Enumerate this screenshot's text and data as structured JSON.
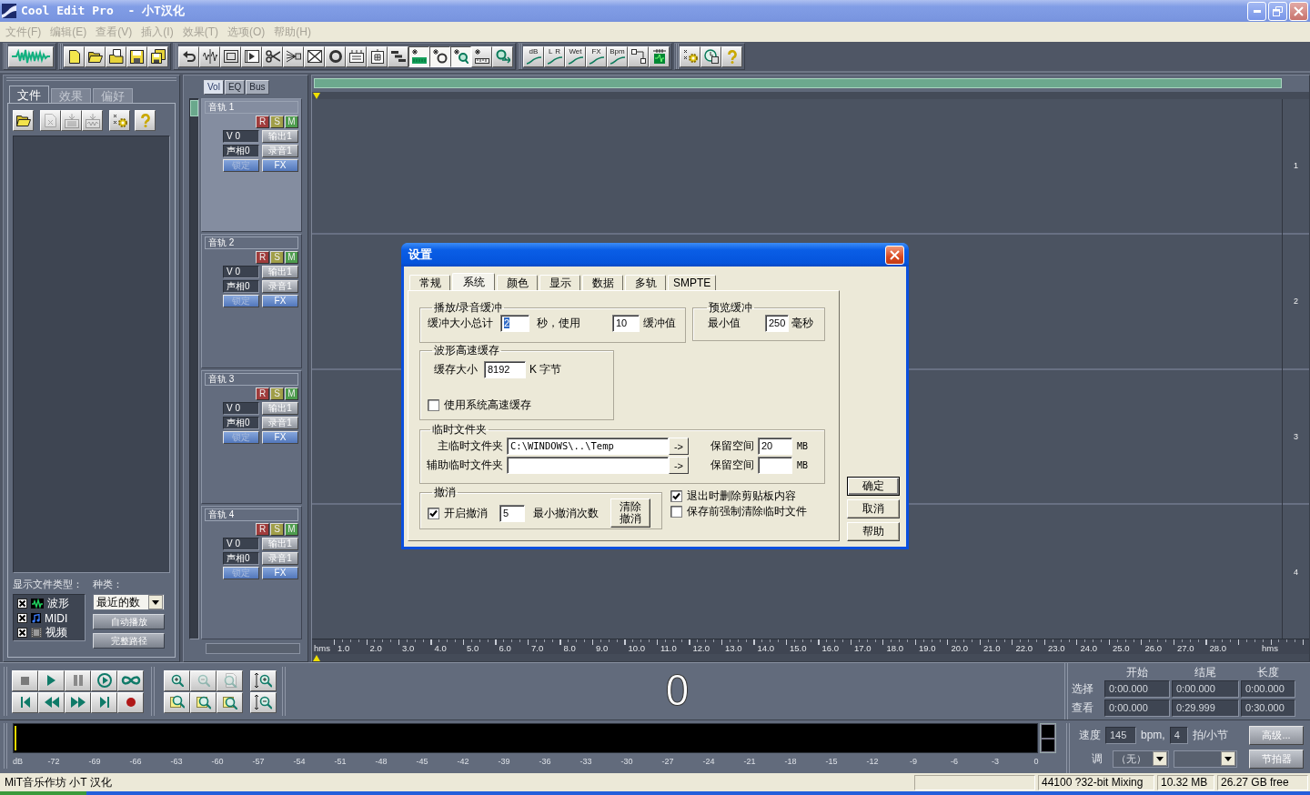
{
  "window": {
    "title": "Cool Edit Pro  - 小T汉化",
    "active": false
  },
  "menu": [
    "文件(F)",
    "编辑(E)",
    "查看(V)",
    "插入(I)",
    "效果(T)",
    "选项(O)",
    "帮助(H)"
  ],
  "toolbar": {
    "groups": [
      [
        {
          "pressed": false
        }
      ],
      [
        {
          "pressed": false
        },
        {
          "pressed": false
        },
        {
          "pressed": false
        },
        {
          "pressed": false
        },
        {
          "pressed": false
        }
      ],
      [
        {
          "pressed": false
        },
        {
          "pressed": false
        },
        {
          "pressed": false
        },
        {
          "pressed": false
        },
        {
          "pressed": false
        },
        {
          "pressed": false
        },
        {
          "pressed": false
        },
        {
          "pressed": false
        },
        {
          "pressed": false
        },
        {
          "pressed": false
        },
        {
          "pressed": false
        },
        {
          "pressed": true
        },
        {
          "pressed": true
        },
        {
          "pressed": true
        },
        {
          "pressed": false
        },
        {
          "pressed": false
        }
      ],
      [
        {
          "pressed": false,
          "labels": [
            "dB"
          ]
        },
        {
          "pressed": false,
          "labels": [
            "L",
            "R"
          ]
        },
        {
          "pressed": false,
          "labels": [
            "Wet"
          ]
        },
        {
          "pressed": false,
          "labels": [
            "FX"
          ]
        },
        {
          "pressed": false,
          "labels": [
            "Bpm"
          ]
        },
        {
          "pressed": false
        },
        {
          "pressed": false
        }
      ],
      [
        {
          "pressed": false
        },
        {
          "pressed": false
        },
        {
          "pressed": false
        }
      ]
    ]
  },
  "file_panel": {
    "tabs": [
      {
        "label": "文件",
        "selected": true
      },
      {
        "label": "效果",
        "selected": false
      },
      {
        "label": "偏好",
        "selected": false
      }
    ],
    "tool_buttons": [
      {
        "disabled": false
      },
      {
        "disabled": true
      },
      {
        "disabled": true
      },
      {
        "disabled": true
      },
      {
        "disabled": false
      },
      {
        "disabled": false
      }
    ],
    "types_label": "显示文件类型：",
    "types": [
      {
        "label": "波形",
        "checked": true
      },
      {
        "label": "MIDI",
        "checked": true
      },
      {
        "label": "视频",
        "checked": true
      }
    ],
    "sort_label": "种类：",
    "sort": "最近的数",
    "buttons": [
      "自动播放",
      "完整路径"
    ]
  },
  "track_tabs": [
    {
      "label": "Vol",
      "selected": true
    },
    {
      "label": "EQ",
      "selected": false
    },
    {
      "label": "Bus",
      "selected": false
    }
  ],
  "tracks": [
    {
      "name": "音轨 1",
      "selected": true,
      "flags": [
        {
          "label": "R",
          "color": "#a03c3c"
        },
        {
          "label": "S",
          "color": "#a09e48"
        },
        {
          "label": "M",
          "color": "#4e9c4e"
        }
      ],
      "volume": "V 0",
      "output": "输出1",
      "pan": "声相0",
      "input": "录音1",
      "lock": {
        "label": "锁定",
        "disabled": true
      },
      "fx": "FX"
    },
    {
      "name": "音轨 2",
      "selected": false,
      "flags": [
        {
          "label": "R",
          "color": "#a03c3c"
        },
        {
          "label": "S",
          "color": "#a09e48"
        },
        {
          "label": "M",
          "color": "#4e9c4e"
        }
      ],
      "volume": "V 0",
      "output": "输出1",
      "pan": "声相0",
      "input": "录音1",
      "lock": {
        "label": "锁定",
        "disabled": true
      },
      "fx": "FX"
    },
    {
      "name": "音轨 3",
      "selected": false,
      "flags": [
        {
          "label": "R",
          "color": "#a03c3c"
        },
        {
          "label": "S",
          "color": "#a09e48"
        },
        {
          "label": "M",
          "color": "#4e9c4e"
        }
      ],
      "volume": "V 0",
      "output": "输出1",
      "pan": "声相0",
      "input": "录音1",
      "lock": {
        "label": "锁定",
        "disabled": true
      },
      "fx": "FX"
    },
    {
      "name": "音轨 4",
      "selected": false,
      "flags": [
        {
          "label": "R",
          "color": "#a03c3c"
        },
        {
          "label": "S",
          "color": "#a09e48"
        },
        {
          "label": "M",
          "color": "#4e9c4e"
        }
      ],
      "volume": "V 0",
      "output": "输出1",
      "pan": "声相0",
      "input": "录音1",
      "lock": {
        "label": "锁定",
        "disabled": true
      },
      "fx": "FX"
    }
  ],
  "lane_numbers": [
    "1",
    "2",
    "3",
    "4"
  ],
  "ruler": {
    "start": "hms",
    "ticks": [
      "1.0",
      "2.0",
      "3.0",
      "4.0",
      "5.0",
      "6.0",
      "7.0",
      "8.0",
      "9.0",
      "10.0",
      "11.0",
      "12.0",
      "13.0",
      "14.0",
      "15.0",
      "16.0",
      "17.0",
      "18.0",
      "19.0",
      "20.0",
      "21.0",
      "22.0",
      "23.0",
      "24.0",
      "25.0",
      "26.0",
      "27.0",
      "28.0"
    ],
    "end": "hms"
  },
  "zoom_buttons": [
    {
      "disabled": false
    },
    {
      "disabled": true
    },
    {
      "disabled": true
    },
    {
      "disabled": false
    },
    {
      "disabled": false
    },
    {
      "disabled": false
    },
    {
      "disabled": false
    },
    {
      "disabled": false
    }
  ],
  "time_display": "0",
  "time_panel": {
    "headers": [
      "开始",
      "结尾",
      "长度"
    ],
    "rows": [
      {
        "label": "选择",
        "values": [
          "0:00.000",
          "0:00.000",
          "0:00.000"
        ]
      },
      {
        "label": "查看",
        "values": [
          "0:00.000",
          "0:29.999",
          "0:30.000"
        ]
      }
    ]
  },
  "meter": {
    "scale": [
      "dB",
      "-72",
      "-69",
      "-66",
      "-63",
      "-60",
      "-57",
      "-54",
      "-51",
      "-48",
      "-45",
      "-42",
      "-39",
      "-36",
      "-33",
      "-30",
      "-27",
      "-24",
      "-21",
      "-18",
      "-15",
      "-12",
      "-9",
      "-6",
      "-3",
      "0"
    ]
  },
  "tempo": {
    "tempo_label": "速度",
    "tempo": "145",
    "bpm": "bpm,",
    "beats": "4",
    "beats_label": "拍/小节",
    "advanced": "高级...",
    "key_label": "调",
    "key": "（无）",
    "metronome": "节拍器"
  },
  "status": {
    "text": "MiT音乐作坊 小T 汉化",
    "panels": [
      "44100 ?32-bit Mixing",
      "10.32 MB",
      "26.27 GB free"
    ]
  },
  "dialog": {
    "title": "设置",
    "active": true,
    "tabs": [
      {
        "label": "常规",
        "selected": false
      },
      {
        "label": "系统",
        "selected": true
      },
      {
        "label": "颜色",
        "selected": false
      },
      {
        "label": "显示",
        "selected": false
      },
      {
        "label": "数据",
        "selected": false
      },
      {
        "label": "多轨",
        "selected": false
      },
      {
        "label": "SMPTE",
        "selected": false
      }
    ],
    "playback": {
      "title": "播放/录音缓冲",
      "size_label": "缓冲大小总计",
      "size": {
        "value": "2",
        "selected": true
      },
      "seconds_label": "秒，使用",
      "buffers": "10",
      "buffers_label": "缓冲值"
    },
    "preview": {
      "title": "预览缓冲",
      "min_label": "最小值",
      "min": "250",
      "unit": "毫秒"
    },
    "wave_cache": {
      "title": "波形高速缓存",
      "size_label": "缓存大小",
      "size": "8192",
      "unit": "K 字节",
      "use_system": {
        "label": "使用系统高速缓存",
        "checked": false
      }
    },
    "temp": {
      "title": "临时文件夹",
      "rows": [
        {
          "label": "主临时文件夹",
          "path": "C:\\WINDOWS\\..\\Temp",
          "browse": "->",
          "reserve_label": "保留空间",
          "reserve": "20",
          "unit": "MB"
        },
        {
          "label": "辅助临时文件夹",
          "browse": "->",
          "reserve_label": "保留空间",
          "unit": "MB"
        }
      ]
    },
    "undo": {
      "title": "撤消",
      "enable": {
        "label": "开启撤消",
        "checked": true
      },
      "levels": "5",
      "levels_label": "最小撤消次数",
      "clear": "清除撤消"
    },
    "options": [
      {
        "label": "退出时删除剪贴板内容",
        "checked": true
      },
      {
        "label": "保存前强制清除临时文件",
        "checked": false
      }
    ],
    "buttons": [
      {
        "label": "确定",
        "default": true
      },
      {
        "label": "取消",
        "default": false
      },
      {
        "label": "帮助",
        "default": false
      }
    ]
  }
}
